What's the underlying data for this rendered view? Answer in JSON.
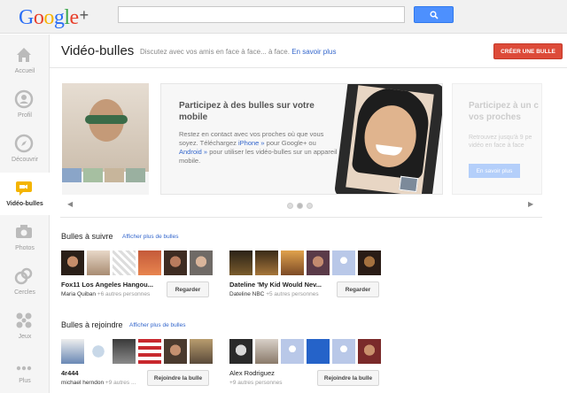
{
  "brand": {
    "logo_letters": [
      "G",
      "o",
      "o",
      "g",
      "l",
      "e",
      "+"
    ],
    "logo_colors": [
      "#2a6ef5",
      "#e83f2b",
      "#f6b400",
      "#2a6ef5",
      "#3aa64a",
      "#e83f2b",
      "#555555"
    ]
  },
  "search": {
    "placeholder": "",
    "button_icon": "search-icon"
  },
  "nav": [
    {
      "label": "Accueil",
      "icon": "home-icon"
    },
    {
      "label": "Profil",
      "icon": "profile-icon"
    },
    {
      "label": "Découvrir",
      "icon": "compass-icon"
    },
    {
      "label": "Vidéo-bulles",
      "icon": "hangout-icon",
      "active": true
    },
    {
      "label": "Photos",
      "icon": "camera-icon"
    },
    {
      "label": "Cercles",
      "icon": "circles-icon"
    },
    {
      "label": "Jeux",
      "icon": "games-icon"
    },
    {
      "label": "Plus",
      "icon": "more-icon"
    }
  ],
  "header": {
    "title": "Vidéo-bulles",
    "subtitle": "Discutez avec vos amis en face à face... à face.",
    "learn_more": "En savoir plus",
    "create_button": "CRÉER UNE BULLE"
  },
  "carousel": {
    "main": {
      "title": "Participez à des bulles sur votre mobile",
      "body_1": "Restez en contact avec vos proches où que vous soyez. Téléchargez ",
      "link_iphone": "iPhone »",
      "body_2": " pour Google+ ou ",
      "link_android": "Android »",
      "body_3": " pour utiliser les vidéo-bulles sur un appareil mobile."
    },
    "right": {
      "title": "Participez à un c vos proches",
      "body": "Retrouvez jusqu'à 9 pe vidéo en face à face",
      "button": "En savoir plus"
    },
    "prev_icon": "chevron-left-icon",
    "next_icon": "chevron-right-icon",
    "dots": 3,
    "active_dot": 1
  },
  "sections": {
    "follow": {
      "title": "Bulles à suivre",
      "link": "Afficher plus de bulles",
      "items": [
        {
          "name": "Fox11 Los Angeles Hangou...",
          "owner": "Maria Quiban",
          "extra": " +6 autres personnes",
          "button": "Regarder"
        },
        {
          "name": "Dateline 'My Kid Would Nev...",
          "owner": "Dateline NBC",
          "extra": " +5 autres personnes",
          "button": "Regarder"
        }
      ]
    },
    "join": {
      "title": "Bulles à rejoindre",
      "link": "Afficher plus de bulles",
      "items": [
        {
          "name": "4r444",
          "owner": "michael herndon",
          "extra": " +9 autres ...",
          "button": "Rejoindre la bulle"
        },
        {
          "name": "Alex Rodriguez",
          "owner": "",
          "extra": "+9 autres personnes",
          "button": "Rejoindre la bulle"
        }
      ]
    }
  },
  "colors": {
    "accent_red": "#dd4b39",
    "accent_blue": "#4d90fe",
    "link": "#3366cc"
  }
}
